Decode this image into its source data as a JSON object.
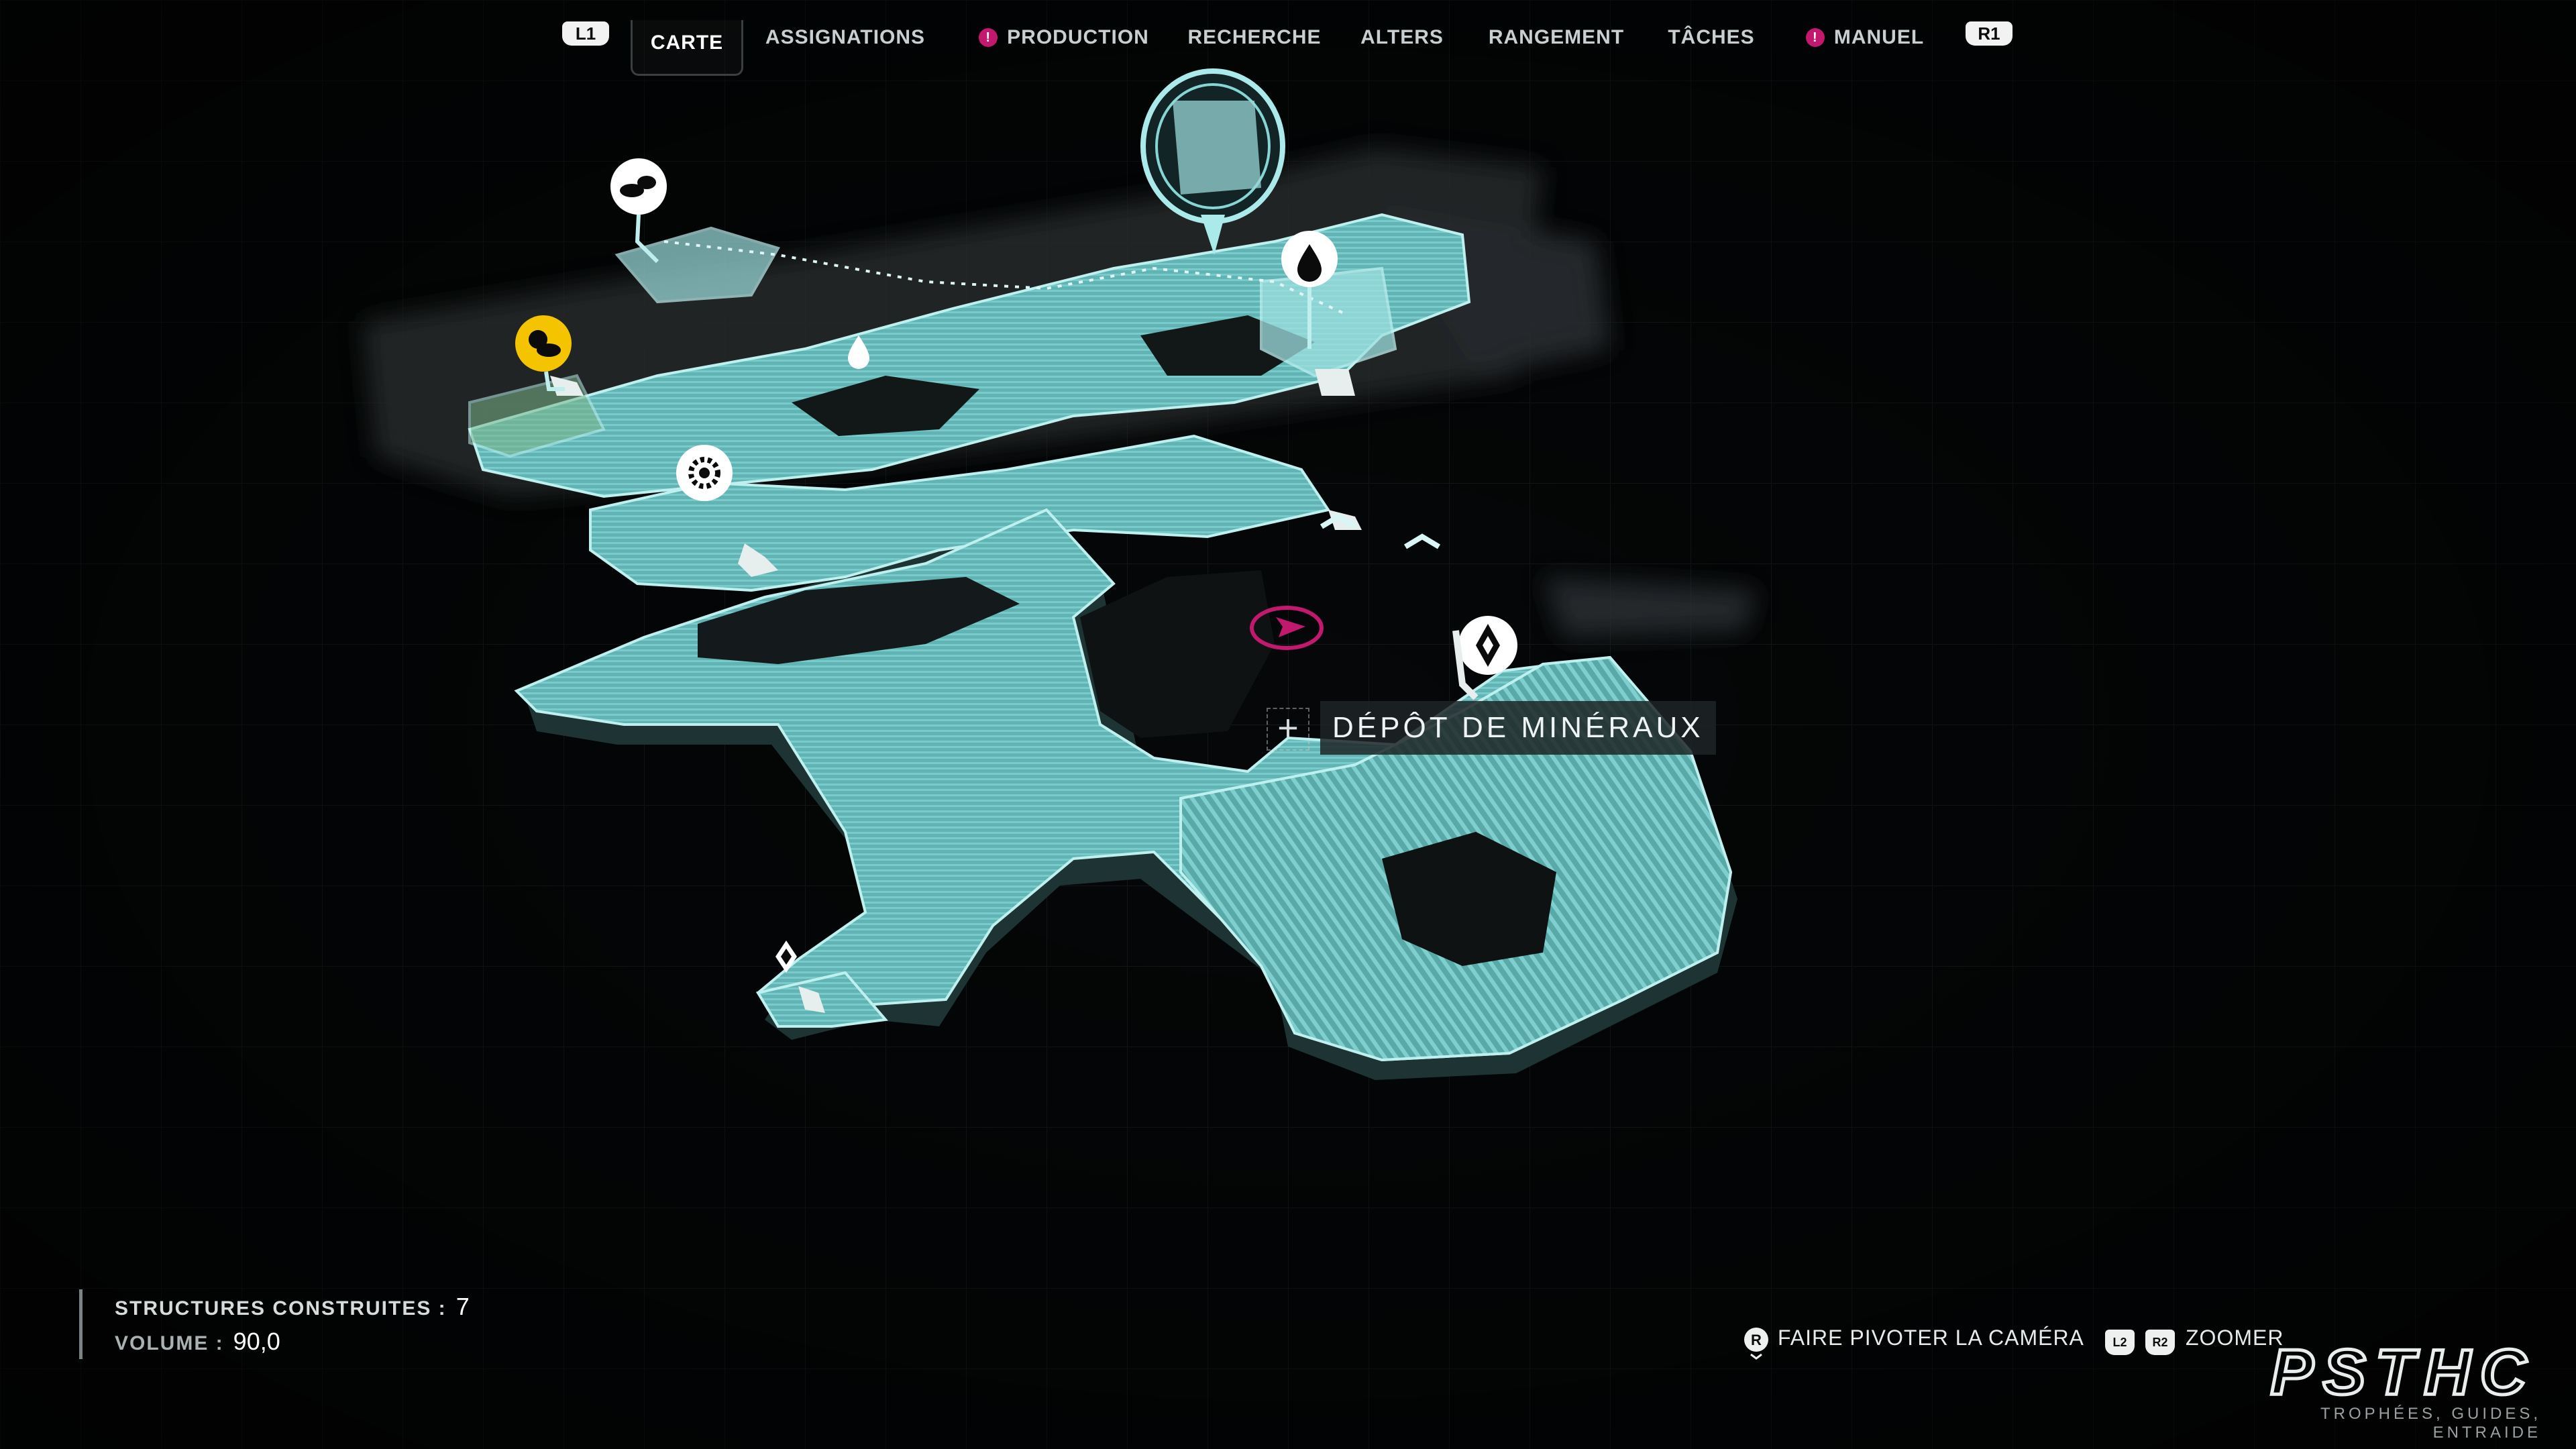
{
  "nav": {
    "left_button": "L1",
    "right_button": "R1",
    "tabs": [
      {
        "label": "CARTE",
        "active": true,
        "alert": false
      },
      {
        "label": "ASSIGNATIONS",
        "active": false,
        "alert": false
      },
      {
        "label": "PRODUCTION",
        "active": false,
        "alert": true
      },
      {
        "label": "RECHERCHE",
        "active": false,
        "alert": false
      },
      {
        "label": "ALTERS",
        "active": false,
        "alert": false
      },
      {
        "label": "RANGEMENT",
        "active": false,
        "alert": false
      },
      {
        "label": "TÂCHES",
        "active": false,
        "alert": false
      },
      {
        "label": "MANUEL",
        "active": false,
        "alert": true
      }
    ],
    "alert_glyph": "!"
  },
  "map": {
    "selected_label": "DÉPÔT DE MINÉRAUX",
    "markers": [
      {
        "icon": "drone-icon",
        "style": "white"
      },
      {
        "icon": "weather-icon",
        "style": "yellow"
      },
      {
        "icon": "water-drop-icon",
        "style": "white"
      },
      {
        "icon": "gear-icon",
        "style": "white"
      },
      {
        "icon": "mineral-deposit-icon",
        "style": "white"
      },
      {
        "icon": "player-location-icon",
        "style": "magenta"
      }
    ],
    "colors": {
      "terrain": "#6fc2c2",
      "accent": "#c2186d",
      "weather": "#f5c400"
    }
  },
  "stats": {
    "structures_label": "STRUCTURES CONSTRUITES :",
    "structures_value": "7",
    "volume_label": "VOLUME :",
    "volume_value": "90,0"
  },
  "controls": {
    "rotate_label": "FAIRE PIVOTER LA CAMÉRA",
    "rotate_button": "R",
    "zoom_buttons": [
      "L2",
      "R2"
    ],
    "zoom_label": "ZOOMER"
  },
  "watermark": {
    "logo": "PSTHC",
    "tagline": "TROPHÉES, GUIDES, ENTRAIDE"
  }
}
